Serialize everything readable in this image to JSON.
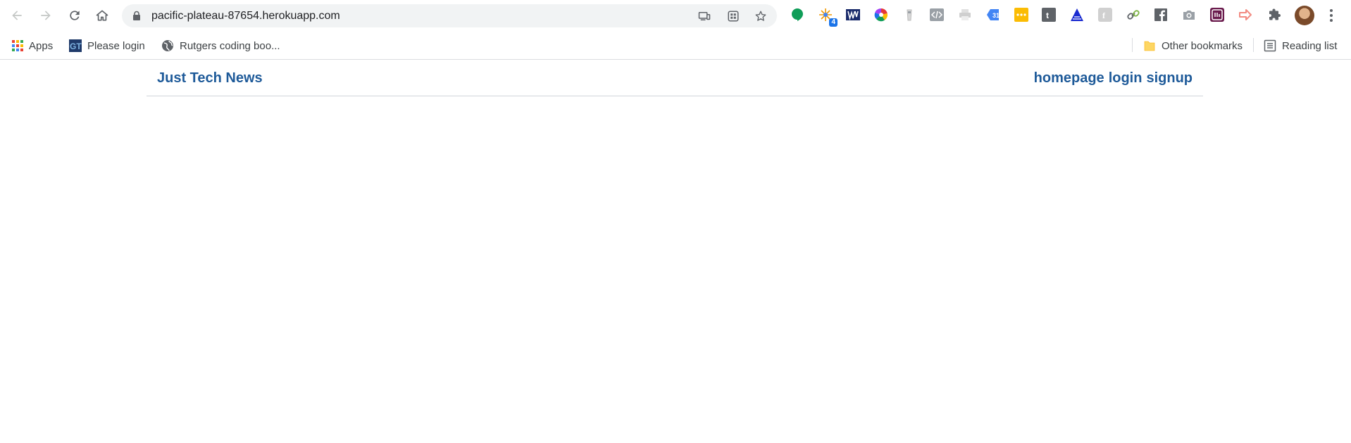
{
  "browser": {
    "url": "pacific-plateau-87654.herokuapp.com",
    "extensions": [
      {
        "name": "hangouts-icon",
        "color": "#0f9d58"
      },
      {
        "name": "sparkle-ext-icon",
        "color": "#f29900",
        "badge": "4"
      },
      {
        "name": "w-ext-icon",
        "color": "#1a2b6b"
      },
      {
        "name": "color-wheel-icon",
        "color": "#e53935"
      },
      {
        "name": "cup-ext-icon",
        "color": "#bdbdbd"
      },
      {
        "name": "code-ext-icon",
        "color": "#9aa0a6"
      },
      {
        "name": "printer-ext-icon",
        "color": "#c7c7c7"
      },
      {
        "name": "calendar-ext-icon",
        "color": "#4285f4"
      },
      {
        "name": "dots-ext-icon",
        "color": "#fbbc04"
      },
      {
        "name": "t-ext-icon",
        "color": "#5f6368"
      },
      {
        "name": "triangle-ext-icon",
        "color": "#1a2bd0"
      },
      {
        "name": "f-ext-icon",
        "color": "#c7c7c7"
      },
      {
        "name": "link-ext-icon",
        "color": "#5f6368"
      },
      {
        "name": "facebook-ext-icon",
        "color": "#5f6368"
      },
      {
        "name": "camera-ext-icon",
        "color": "#9aa0a6"
      },
      {
        "name": "terminal-ext-icon",
        "color": "#6a1b4d"
      },
      {
        "name": "arrow-ext-icon",
        "color": "#f28b82"
      },
      {
        "name": "puzzle-icon",
        "color": "#5f6368"
      }
    ]
  },
  "bookmarks": {
    "apps_label": "Apps",
    "items": [
      {
        "label": "Please login"
      },
      {
        "label": "Rutgers coding boo..."
      }
    ],
    "other_label": "Other bookmarks",
    "reading_list_label": "Reading list"
  },
  "site": {
    "title": "Just Tech News",
    "nav": [
      {
        "label": "homepage"
      },
      {
        "label": "login"
      },
      {
        "label": "signup"
      }
    ],
    "link_color": "#1e5a99"
  }
}
